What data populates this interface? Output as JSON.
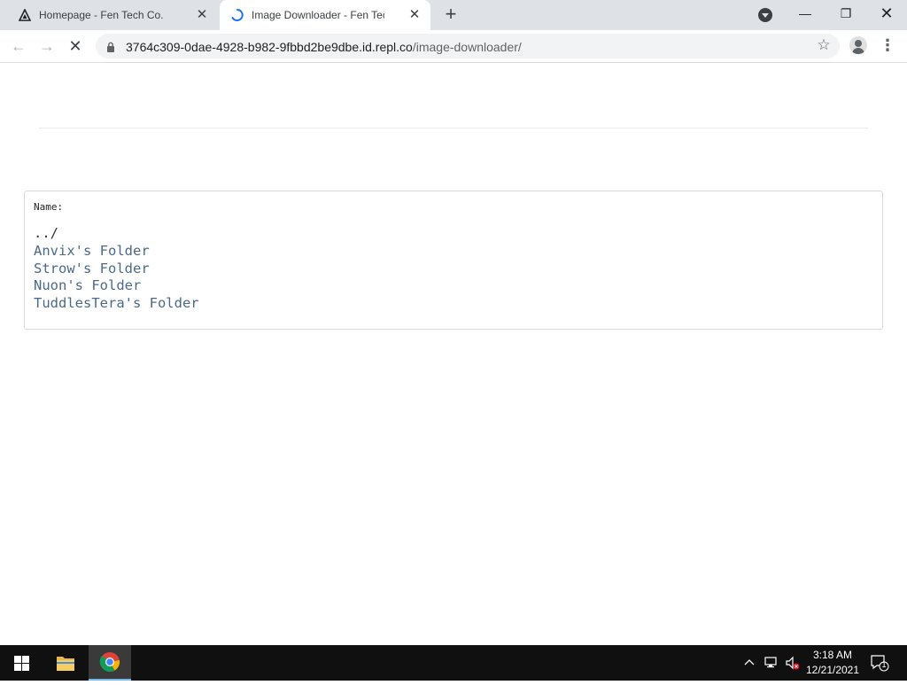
{
  "browser": {
    "tabs": [
      {
        "title": "Homepage - Fen Tech Co.",
        "active": false
      },
      {
        "title": "Image Downloader - Fen Tech Co.",
        "active": true
      }
    ],
    "url": {
      "host": "3764c309-0dae-4928-b982-9fbbd2be9dbe.id.repl.co",
      "path": "/image-downloader/"
    }
  },
  "page": {
    "listing": {
      "header": "Name:",
      "parent": "../",
      "items": [
        "Anvix's Folder",
        "Strow's Folder",
        "Nuon's Folder",
        "TuddlesTera's Folder"
      ]
    }
  },
  "taskbar": {
    "time": "3:18 AM",
    "date": "12/21/2021",
    "notification_count": "1"
  },
  "colors": {
    "link": "#4a6a8a",
    "taskbar": "#101010",
    "tabstrip": "#dee1e6"
  }
}
